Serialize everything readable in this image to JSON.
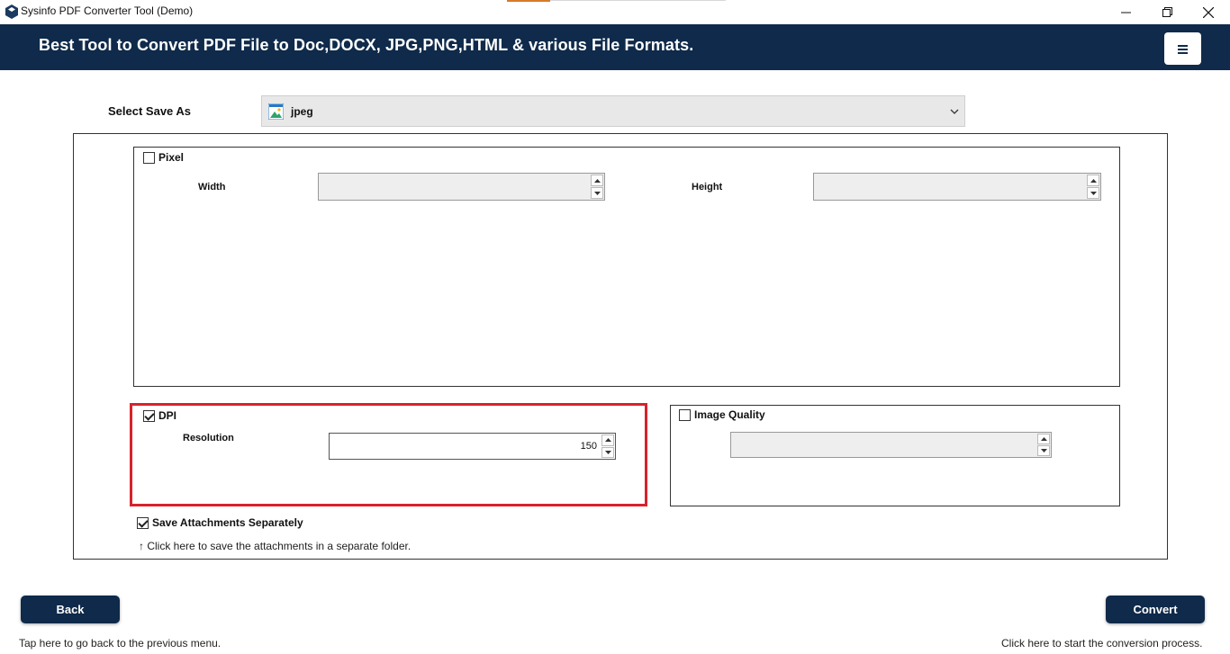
{
  "window": {
    "title": "Sysinfo PDF Converter Tool (Demo)",
    "controls": {
      "minimize": "—",
      "maximize": "❐",
      "close": "✕"
    }
  },
  "banner": {
    "text": "Best Tool to Convert PDF File to Doc,DOCX, JPG,PNG,HTML & various File Formats.",
    "menu_icon": "hamburger-icon"
  },
  "save_as": {
    "label": "Select Save As",
    "selected": "jpeg",
    "icon": "image-file-icon"
  },
  "pixel": {
    "checkbox_label": "Pixel",
    "checked": false,
    "width_label": "Width",
    "width_value": "",
    "height_label": "Height",
    "height_value": ""
  },
  "dpi": {
    "checkbox_label": "DPI",
    "checked": true,
    "resolution_label": "Resolution",
    "resolution_value": "150",
    "highlight_color": "#d8222c"
  },
  "image_quality": {
    "checkbox_label": "Image Quality",
    "checked": false,
    "value": ""
  },
  "attachments": {
    "checkbox_label": "Save Attachments Separately",
    "checked": true,
    "hint": "↑ Click here to save the attachments in a separate folder."
  },
  "footer": {
    "back_label": "Back",
    "back_hint": "Tap here to go back to the previous menu.",
    "convert_label": "Convert",
    "convert_hint": "Click here to start the conversion process."
  },
  "colors": {
    "brand_navy": "#0f2a4a",
    "accent_orange": "#d77a2a"
  }
}
